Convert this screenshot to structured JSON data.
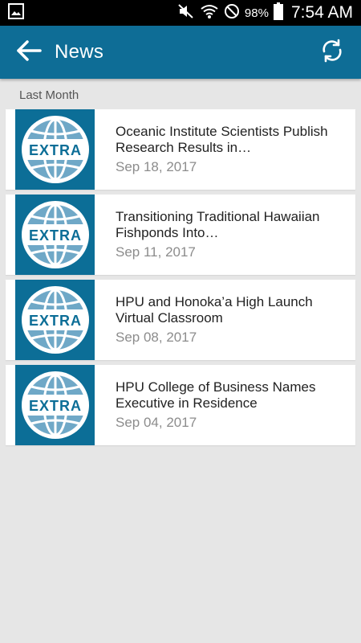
{
  "status_bar": {
    "battery_percent": "98%",
    "time": "7:54 AM",
    "icons": [
      "gallery-icon",
      "mute-icon",
      "wifi-icon",
      "no-disturb-icon",
      "battery-icon"
    ]
  },
  "app_bar": {
    "title": "News",
    "back_icon": "arrow-left-icon",
    "refresh_icon": "refresh-icon"
  },
  "section": {
    "label": "Last Month"
  },
  "news": [
    {
      "thumb_label": "EXTRA",
      "title": "Oceanic Institute Scientists Publish Research Results in…",
      "date": "Sep 18, 2017"
    },
    {
      "thumb_label": "EXTRA",
      "title": "Transitioning Traditional Hawaiian Fishponds Into…",
      "date": "Sep 11, 2017"
    },
    {
      "thumb_label": "EXTRA",
      "title": "HPU and Honoka’a High Launch Virtual Classroom",
      "date": "Sep 08, 2017"
    },
    {
      "thumb_label": "EXTRA",
      "title": "HPU College of Business Names Executive in Residence",
      "date": "Sep 04, 2017"
    }
  ],
  "colors": {
    "brand": "#0e6d96",
    "thumb_bg": "#0c6e97",
    "background": "#e6e6e6"
  }
}
